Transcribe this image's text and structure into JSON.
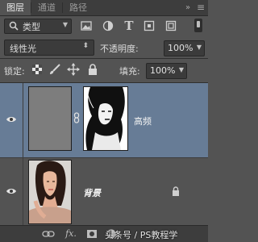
{
  "tabs": [
    {
      "label": "图层",
      "active": true
    },
    {
      "label": "通道",
      "active": false
    },
    {
      "label": "路径",
      "active": false
    }
  ],
  "filter": {
    "label": "类型",
    "icons": [
      "image-filter-icon",
      "adjustment-filter-icon",
      "type-filter-icon",
      "shape-filter-icon",
      "smart-object-filter-icon"
    ]
  },
  "blend": {
    "mode": "线性光",
    "opacity_label": "不透明度:",
    "opacity": "100%"
  },
  "lock": {
    "label": "锁定:",
    "fill_label": "填充:",
    "fill": "100%"
  },
  "layers": [
    {
      "name": "高频",
      "selected": true,
      "has_mask": true
    },
    {
      "name": "背景",
      "selected": false,
      "locked": true
    }
  ],
  "watermark": "头条号 / PS教程学",
  "colors": {
    "panel": "#535353",
    "selected_layer": "#677c96",
    "tabbar": "#3d3d3d"
  }
}
